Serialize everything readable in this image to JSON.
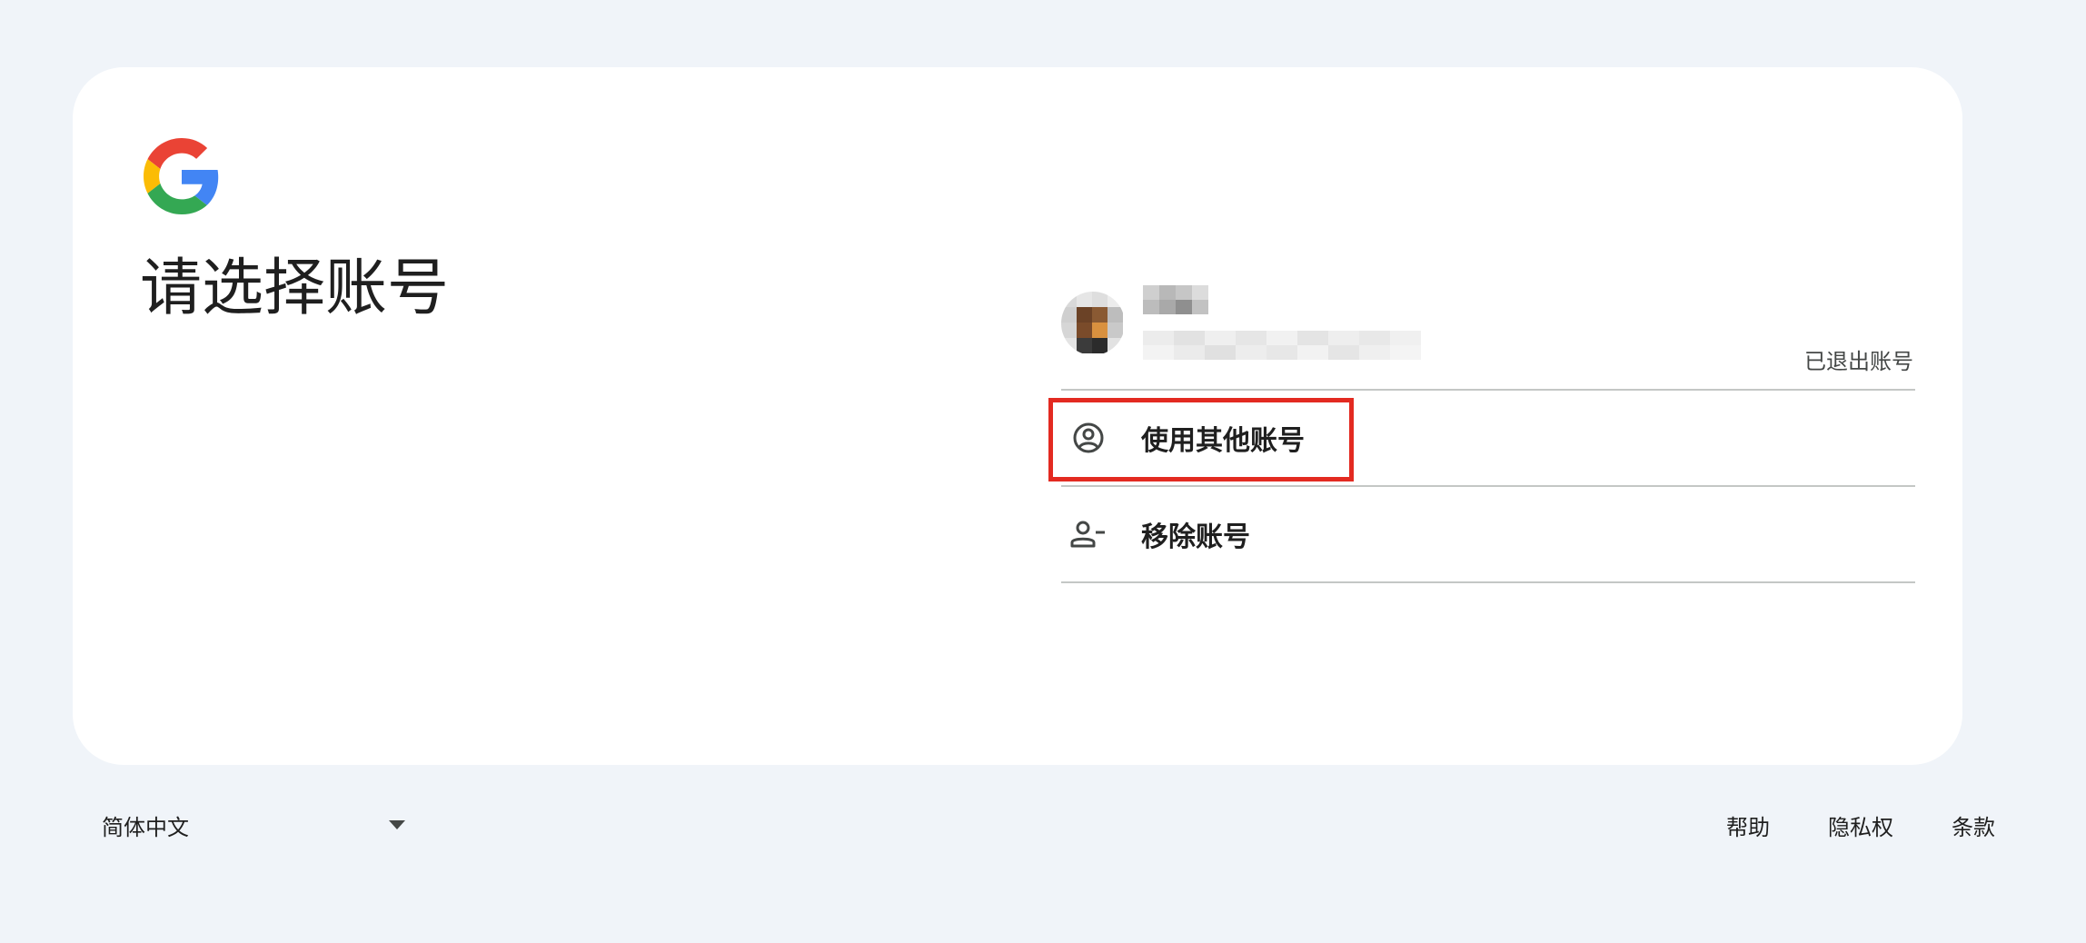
{
  "page": {
    "title": "请选择账号"
  },
  "account": {
    "status": "已退出账号"
  },
  "options": {
    "use_other_account": "使用其他账号",
    "remove_account": "移除账号"
  },
  "footer": {
    "language": "简体中文",
    "help": "帮助",
    "privacy": "隐私权",
    "terms": "条款"
  },
  "icons": {
    "logo": "google-g-logo",
    "use_other_account": "account-circle-icon",
    "remove_account": "person-remove-icon",
    "language_dropdown": "caret-down-icon"
  },
  "colors": {
    "background": "#f0f4f9",
    "card": "#ffffff",
    "highlight_box": "#e32a21",
    "divider": "#c4c7c5",
    "google_blue": "#4285f4",
    "google_red": "#ea4335",
    "google_yellow": "#fbbc05",
    "google_green": "#34a853"
  }
}
